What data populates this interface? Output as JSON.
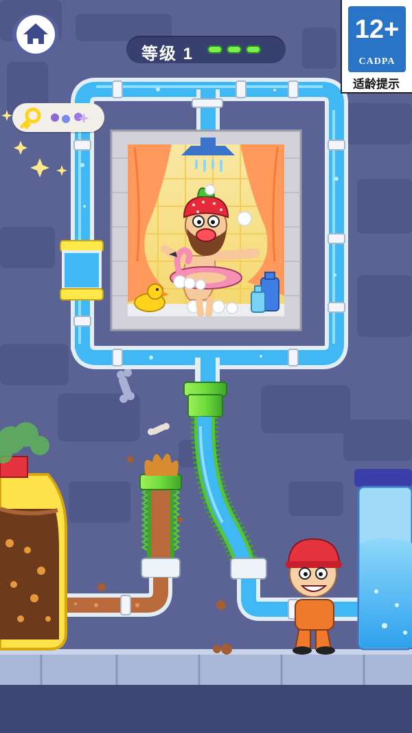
{
  "hud": {
    "level_label": "等级 1",
    "level_pips_total": 3,
    "level_pips_filled": 3
  },
  "age_rating": {
    "rating": "12+",
    "organization": "CADPA",
    "label": "适龄提示"
  },
  "colors": {
    "water": "#3fb8f4",
    "pipe_frame": "#dfeaf3",
    "pipe_green": "#6fdc3c",
    "dirty_water": "#b86a3a",
    "background": "#5a6394"
  },
  "icons": [
    "home-icon",
    "key-icon",
    "shower-icon",
    "rubber-duck-icon",
    "flamingo-float-icon"
  ]
}
